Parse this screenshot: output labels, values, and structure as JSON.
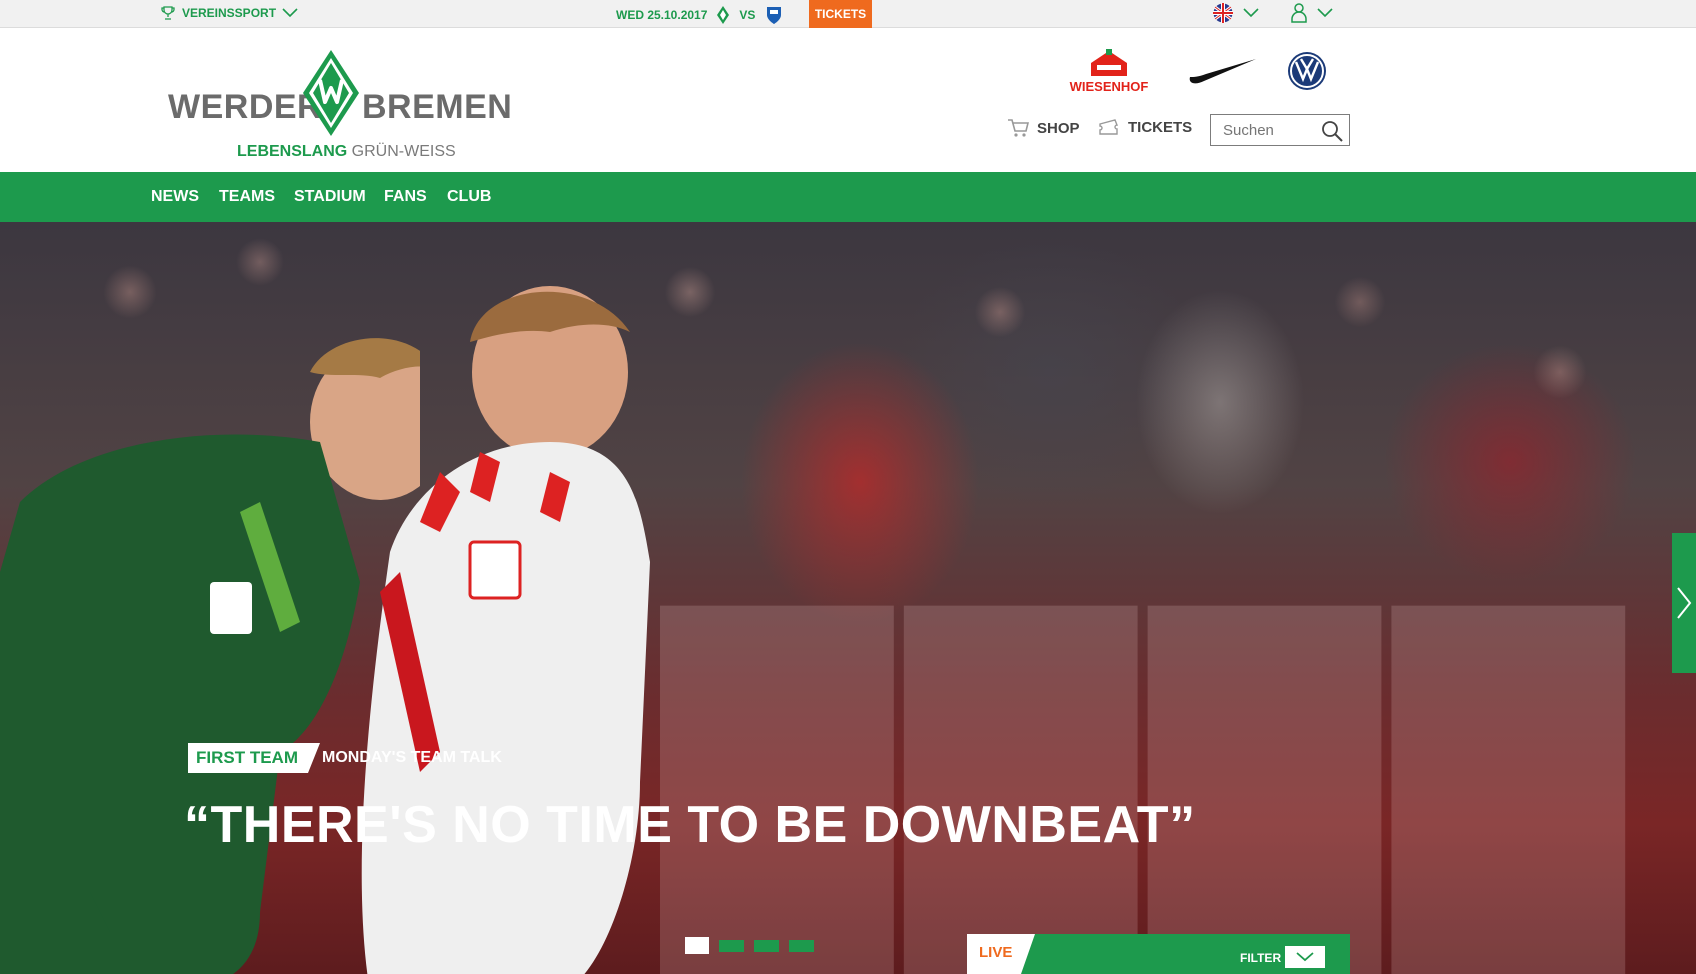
{
  "topbar": {
    "vereinssport_label": "VEREINSSPORT",
    "match_date": "WED 25.10.2017",
    "vs_label": "VS",
    "tickets_label": "TICKETS"
  },
  "header": {
    "logo_left": "WERDER",
    "logo_right": "BREMEN",
    "tagline_strong": "LEBENSLANG",
    "tagline_rest": " GRÜN-WEISS",
    "sponsor_wiesenhof": "WIESENHOF",
    "shop_label": "SHOP",
    "tickets_label": "TICKETS",
    "search_placeholder": "Suchen"
  },
  "nav": {
    "items": [
      {
        "label": "NEWS"
      },
      {
        "label": "TEAMS"
      },
      {
        "label": "STADIUM"
      },
      {
        "label": "FANS"
      },
      {
        "label": "CLUB"
      }
    ]
  },
  "hero": {
    "kicker_tag": "FIRST TEAM",
    "kicker_sub": "MONDAY'S TEAM TALK",
    "headline": "“THERE'S NO TIME TO BE DOWNBEAT”",
    "slide_count": 4,
    "active_slide": 1
  },
  "live": {
    "label": "LIVE",
    "filter_label": "FILTER"
  },
  "colors": {
    "brand_green": "#1d9a4d",
    "accent_orange": "#ef6a1e"
  }
}
